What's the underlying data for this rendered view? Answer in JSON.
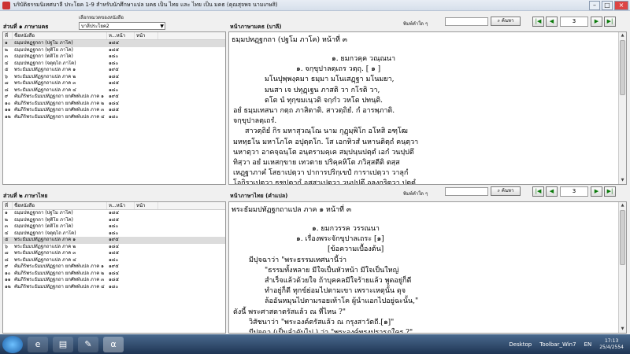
{
  "window": {
    "title": "บริบัติธรรมนิเทศบาลี ประโยค 1-9 สำหรับนักศึกษาแปล มคธ เป็น ไทย และ ไทย เป็น มคธ (คุณสุจพจ นามเกษสิ)"
  },
  "left_top": {
    "section_label": "ส่วนที่ ๑ ภาษามคธ",
    "group_label": "เลือกหมวดของหนังสือ",
    "group_value": "บาลีประโยค2",
    "columns": [
      "ที่",
      "ชื่อหนังสือ",
      "ห...หน้า",
      "หน้า"
    ],
    "rows": [
      [
        "๑",
        "ธมฺมปทฏฺฐกถา (ปฐโม ภาโค)",
        "๑๘๔",
        ""
      ],
      [
        "๒",
        "ธมฺมปทฏฺฐกถา (ทุติโย ภาโค)",
        "๑๘๕",
        ""
      ],
      [
        "๓",
        "ธมฺมปทฏฺฐกถา (ตติโย ภาโค)",
        "๑๘๐",
        ""
      ],
      [
        "๔",
        "ธมฺมปทฏฺฐกถา (จตุตฺโถ ภาโค)",
        "๑๘๐",
        ""
      ],
      [
        "๕",
        "พระธัมมปทัฏฐกถาแปล ภาค ๑",
        "๑๙๕",
        ""
      ],
      [
        "๖",
        "พระธัมมปทัฏฐกถาแปล ภาค ๒",
        "๑๘๔",
        ""
      ],
      [
        "๗",
        "พระธัมมปทัฏฐกถาแปล ภาค ๓",
        "๑๘๕",
        ""
      ],
      [
        "๘",
        "พระธัมมปทัฏฐกถาแปล ภาค ๔",
        "๑๘๐",
        ""
      ],
      [
        "๙",
        "คัมภีร์พระธัมมปทัฏฐกถา ยกศัพท์แปล ภาค ๑",
        "๑๙๕",
        ""
      ],
      [
        "๑๐",
        "คัมภีร์พระธัมมปทัฏฐกถา ยกศัพท์แปล ภาค ๒",
        "๑๘๔",
        ""
      ],
      [
        "๑๑",
        "คัมภีร์พระธัมมปทัฏฐกถา ยกศัพท์แปล ภาค ๓",
        "๑๘๕",
        ""
      ],
      [
        "๑๒",
        "คัมภีร์พระธัมมปทัฏฐกถา ยกศัพท์แปล ภาค ๔",
        "๑๘๐",
        ""
      ]
    ]
  },
  "left_bottom": {
    "section_label": "ส่วนที่ ๒ ภาษาไทย",
    "columns": [
      "ที่",
      "ชื่อหนังสือ",
      "ห...หน้า",
      "หน้า"
    ],
    "rows": [
      [
        "๑",
        "ธมฺมปทฏฺฐกถา (ปฐโม ภาโค)",
        "๑๘๔",
        ""
      ],
      [
        "๒",
        "ธมฺมปทฏฺฐกถา (ทุติโย ภาโค)",
        "๑๘๕",
        ""
      ],
      [
        "๓",
        "ธมฺมปทฏฺฐกถา (ตติโย ภาโค)",
        "๑๘๐",
        ""
      ],
      [
        "๔",
        "ธมฺมปทฏฺฐกถา (จตุตฺโถ ภาโค)",
        "๑๘๐",
        ""
      ],
      [
        "๕",
        "พระธัมมปทัฏฐกถาแปล ภาค ๑",
        "๑๙๕",
        ""
      ],
      [
        "๖",
        "พระธัมมปทัฏฐกถาแปล ภาค ๒",
        "๑๘๔",
        ""
      ],
      [
        "๗",
        "พระธัมมปทัฏฐกถาแปล ภาค ๓",
        "๑๘๕",
        ""
      ],
      [
        "๘",
        "พระธัมมปทัฏฐกถาแปล ภาค ๔",
        "๑๘๐",
        ""
      ],
      [
        "๙",
        "คัมภีร์พระธัมมปทัฏฐกถา ยกศัพท์แปล ภาค ๑",
        "๑๙๕",
        ""
      ],
      [
        "๑๐",
        "คัมภีร์พระธัมมปทัฏฐกถา ยกศัพท์แปล ภาค ๒",
        "๑๘๔",
        ""
      ],
      [
        "๑๑",
        "คัมภีร์พระธัมมปทัฏฐกถา ยกศัพท์แปล ภาค ๓",
        "๑๘๕",
        ""
      ],
      [
        "๑๒",
        "คัมภีร์พระธัมมปทัฏฐกถา ยกศัพท์แปล ภาค ๔",
        "๑๘๐",
        ""
      ]
    ]
  },
  "pali_pane": {
    "label": "หน้าภาษามคธ (บาลี)",
    "search_label": "พิมพ์คำใด ๆ",
    "find_button": "ค้นหา",
    "page": "3",
    "heading": "ธมฺมปทฏฺฐกถา (ปฐโม ภาโค) หน้าที่ ๓",
    "lines": [
      "๑. ยมกวคฺค วณฺณนา",
      "๑. จกฺขุปาลตฺเถร วตฺถุ. [ ๑ ]",
      "มโนปุพฺพงฺคมา  ธมฺมา               มโนเสฏฺฐา มโนมยา,",
      "มนสา เจ ปทุฏฺเฐน                   ภาสติ วา กโรติ วา,",
      "ตโต  นํ  ทุกฺขมเนฺวติ               จกฺกํว วหโต ปทนฺติ.",
      "อยํ  ธมฺมเทสนา  กตฺถ  ภาสิตาติ.  สาวตฺถิยํ.  กํ อารพฺภาติ.",
      "จกฺขุปาลตฺเถรํ.",
      "สาวตฺถิยํ  กิร  มหาสุวณฺโณ  นาม  กุฏุมฺพิโก  อโหสิ อฑฺโฒ",
      "มหทฺธโน  มหาโภโค  อปุตฺตโก.  โส  เอกทิวสํ  นหานติตฺถํ  คนฺตฺวา",
      "นหาตฺวา  อาคจฺฉนฺโต  อนฺตรามคฺเค  สมฺปนฺนปตฺตํ  เอกํ  วนปฺปตึ",
      "ทิสฺวา  อยํ  มเหสกฺขาย  เทวตาย  ปริคฺคหิโต  ภวิสฺสตีติ  ตสฺส",
      "เหฏฺฐาภาคํ  โสธาเปตฺวา  ปาการปริกฺเขปํ  การาเปตฺวา  วาลุกํ",
      "โอกิราเปตฺวา  ธชปตากํ  อุสฺสาเปตฺวา  วนปฺปตึ  อลงฺกริตฺวา  ปุตฺตํ"
    ]
  },
  "thai_pane": {
    "label": "หน้าภาษาไทย (คำแปล)",
    "search_label": "พิมพ์คำใด ๆ",
    "find_button": "ค้นหา",
    "page": "3",
    "heading": "พระธัมมปทัฏฐกถาแปล ภาค ๑ หน้าที่ ๓",
    "lines": [
      "๑. ยมกวรรค วรรณนา",
      "๑. เรื่องพระจักขุปาลเถระ [๑]",
      "[ข้อความเบื้องต้น]",
      "มีปุจฉาว่า  \"พระธรรมเทศนานี้ว่า",
      "\"ธรรมทั้งหลาย มีใจเป็นหัวหน้า มีใจเป็นใหญ่",
      "สำเร็จแล้วด้วยใจ  ถ้าบุคคลมีใจร้ายแล้ว  พูดอยู่ก็ดี",
      "ทำอยู่ก็ดี  ทุกข์ย่อมไปตามเขา  เพราะเหตุนั้น  ดุจ",
      "ล้ออันหมุนไปตามรอยเท้าโค  ผู้นำแอกไปอยู่ฉะนั้น,\"",
      "ดังนี้  พระศาสดาตรัสแล้ว  ณ  ที่ไหน ?\"",
      "วิสัชนาว่า  \"พระองค์ตรัสแล้ว  ณ  กรุงสาวัตถี.[๑]\"",
      "มีปุจฉา (เป็นลำดับไป ) ว่า  \"พระองค์ทรงปรารภใคร ?\""
    ]
  },
  "taskbar": {
    "desktop_label": "Desktop",
    "toolbar_label": "Toolbar_Win7",
    "lang": "EN",
    "time": "17:13",
    "date": "25/4/2554"
  }
}
